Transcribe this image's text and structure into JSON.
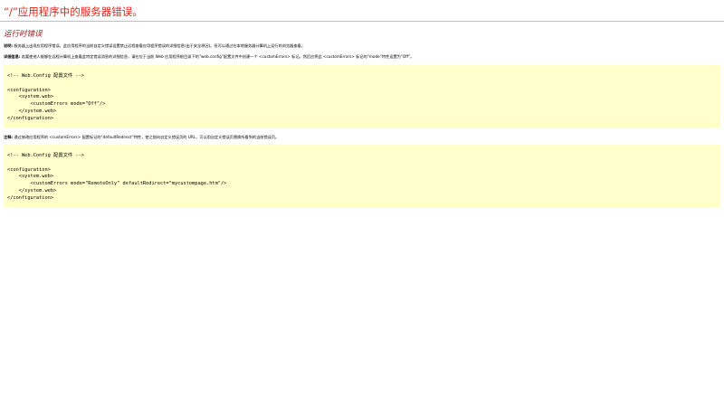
{
  "page": {
    "title": "“/”应用程序中的服务器错误。",
    "subtitle": "运行时错误"
  },
  "description": {
    "label": "说明:",
    "text": " 服务器上出现应用程序错误。此应用程序的当前自定义错误设置禁止远程查看应用程序错误的详细信息(出于安全原因)。但可以通过在本地服务器计算机上运行的浏览器查看。"
  },
  "details": {
    "label": "详细信息:",
    "text": " 若要使他人能够在远程计算机上查看此特定错误消息的详细信息，请在位于当前 Web 应用程序根目录下的“web.config”配置文件中创建一个 <customErrors> 标记。然后应将此 <customErrors> 标记的“mode”特性设置为“Off”。"
  },
  "notes": {
    "label": "注释:",
    "text": " 通过修改应用程序的 <customErrors> 配置标记的“defaultRedirect”特性，使之指向自定义错误页的 URL，可以用自定义错误页替换所看到的当前错误页。"
  },
  "code_block_1": [
    "<!-- Web.Config 配置文件 -->",
    "",
    "<configuration>",
    "    <system.web>",
    "        <customErrors mode=\"Off\"/>",
    "    </system.web>",
    "</configuration>"
  ],
  "code_block_2": [
    "<!-- Web.Config 配置文件 -->",
    "",
    "<configuration>",
    "    <system.web>",
    "        <customErrors mode=\"RemoteOnly\" defaultRedirect=\"mycustompage.htm\"/>",
    "    </system.web>",
    "</configuration>"
  ],
  "colors": {
    "title": "#e2231a",
    "subtitle": "#8b1a1a",
    "code_background": "#ffffcc"
  }
}
